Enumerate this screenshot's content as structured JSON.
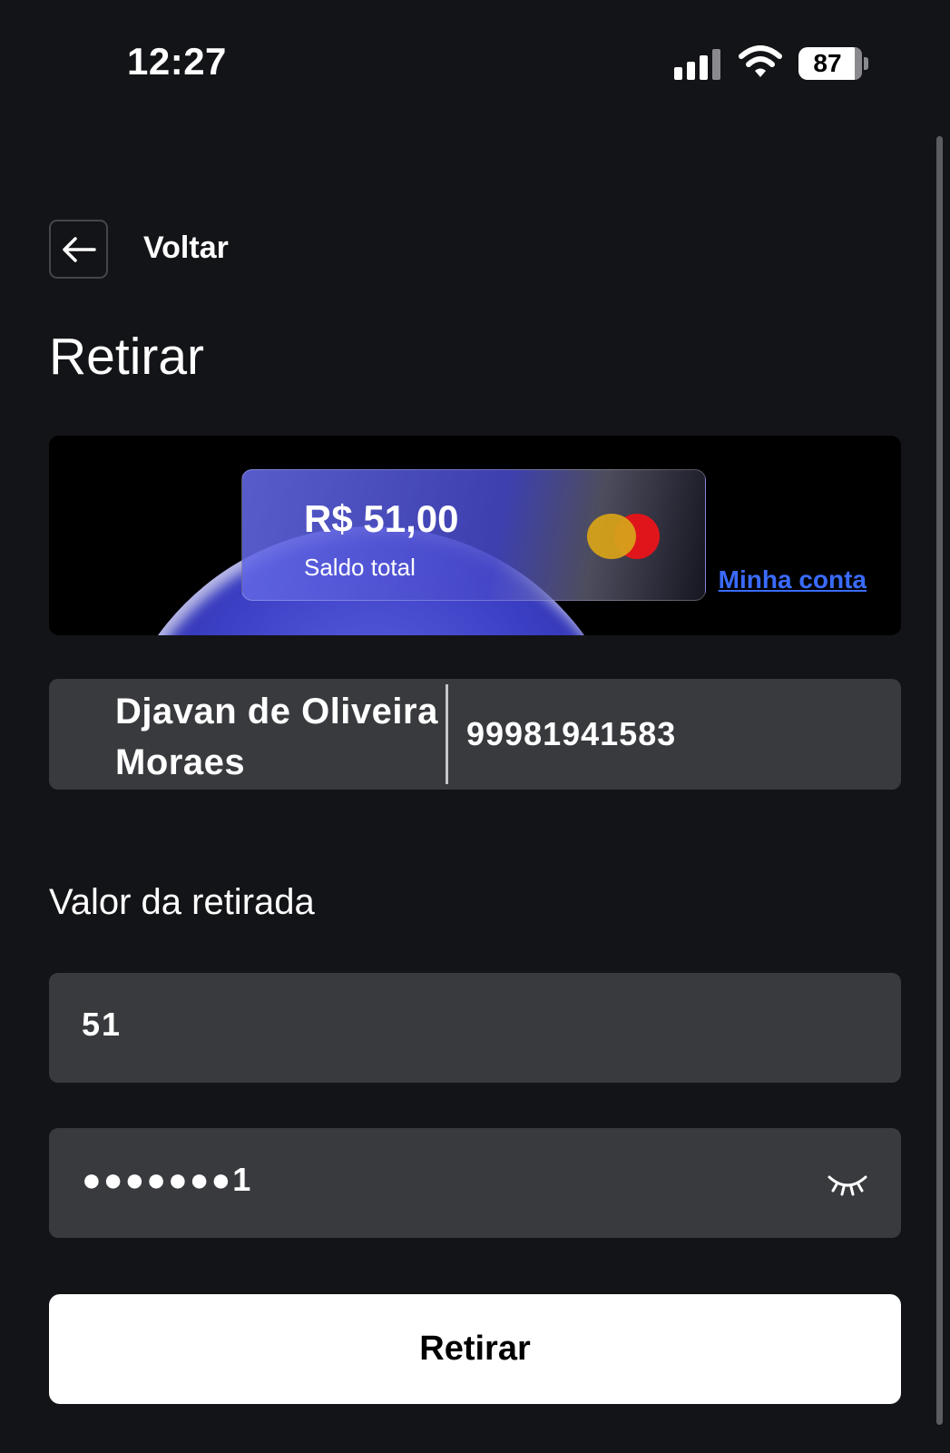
{
  "status_bar": {
    "time": "12:27",
    "battery": "87"
  },
  "nav": {
    "back_label": "Voltar"
  },
  "page": {
    "title": "Retirar"
  },
  "balance_card": {
    "amount": "R$ 51,00",
    "label": "Saldo total",
    "link": "Minha conta"
  },
  "account": {
    "name": "Djavan de Oliveira Moraes",
    "number": "99981941583"
  },
  "withdraw": {
    "section_label": "Valor da retirada",
    "amount_value": "51",
    "password_value": "●●●●●●●1"
  },
  "submit": {
    "label": "Retirar"
  },
  "colors": {
    "background": "#131417",
    "field": "#383a3e",
    "link": "#3a6bff",
    "button": "#ffffff"
  },
  "icons": {
    "back": "arrow-left-icon",
    "visibility": "eye-closed-icon",
    "card_brand": "mastercard-logo"
  }
}
